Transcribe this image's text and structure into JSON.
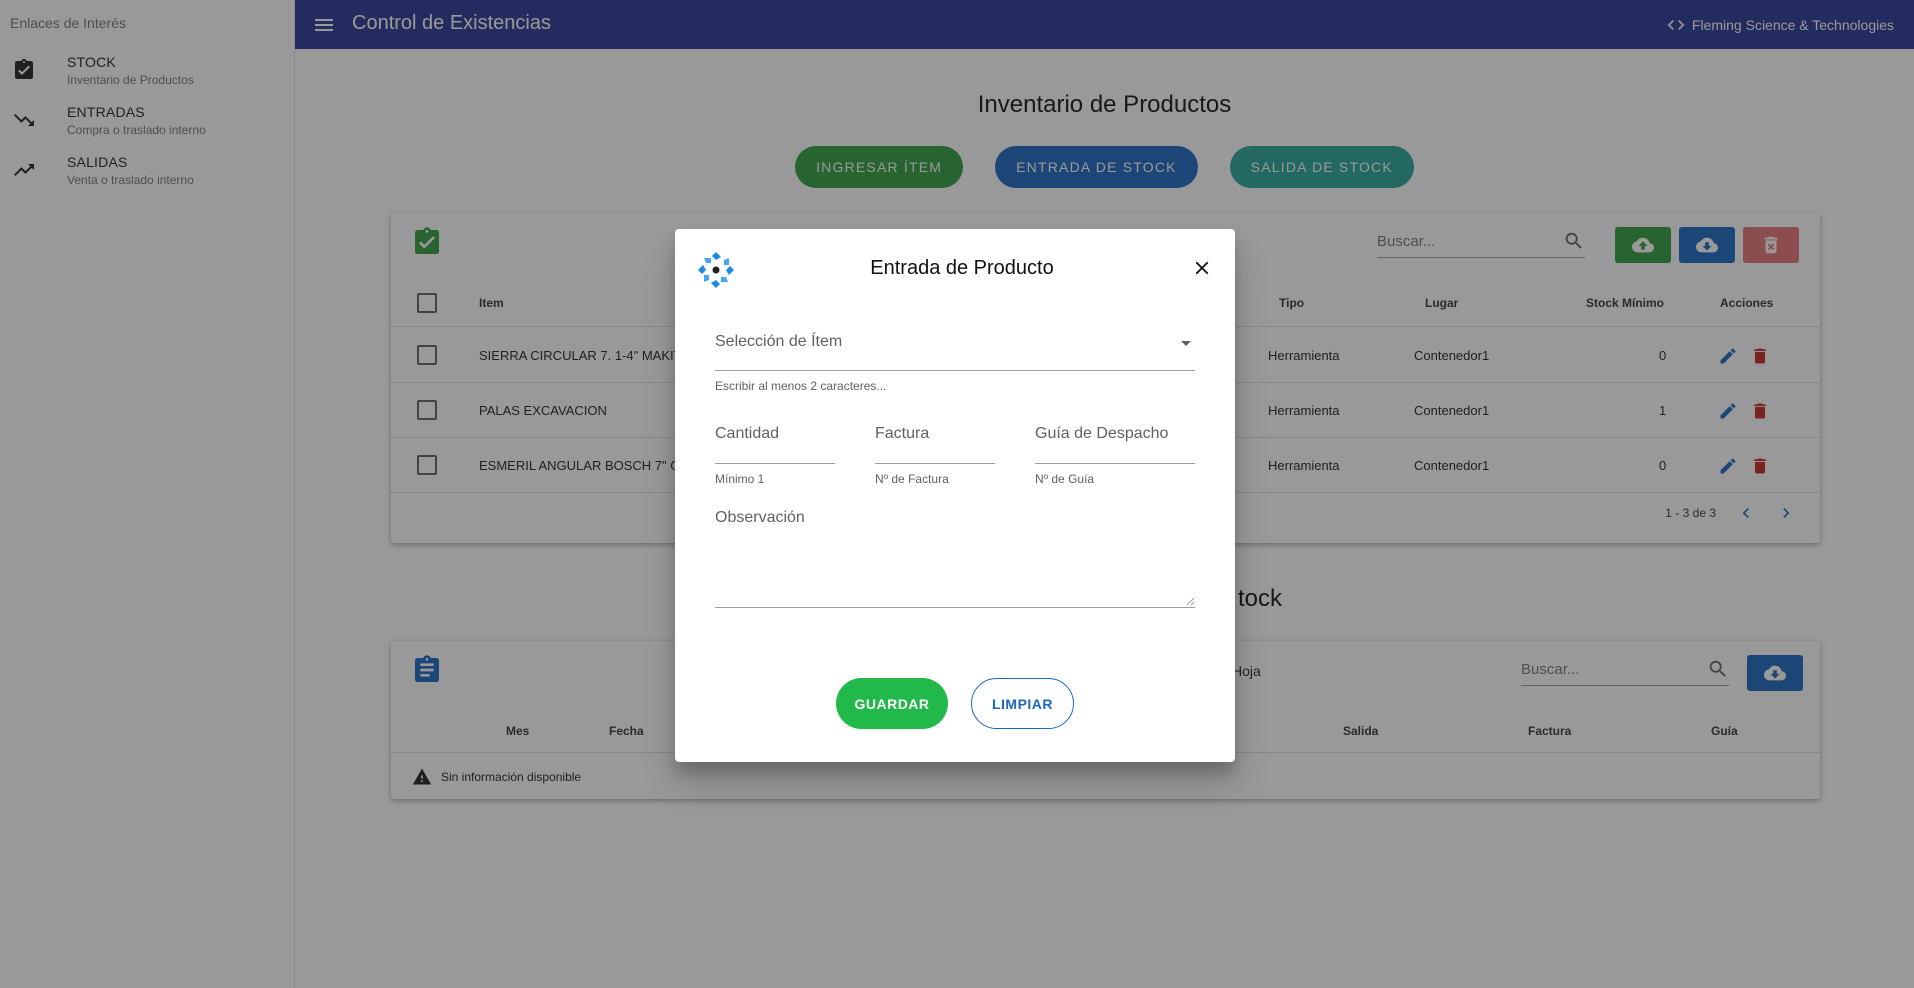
{
  "sidebar": {
    "title": "Enlaces de Interés",
    "items": [
      {
        "label": "STOCK",
        "sub": "Inventario de Productos",
        "icon": "clipboard-check-icon"
      },
      {
        "label": "ENTRADAS",
        "sub": "Compra o traslado interno",
        "icon": "trending-down-icon"
      },
      {
        "label": "SALIDAS",
        "sub": "Venta o traslado interno",
        "icon": "trending-up-icon"
      }
    ]
  },
  "appbar": {
    "title": "Control de Existencias",
    "brand": "Fleming Science & Technologies",
    "color": "#283593"
  },
  "main": {
    "title": "Inventario de Productos",
    "buttons": {
      "add_item": "INGRESAR ÍTEM",
      "stock_in": "ENTRADA DE STOCK",
      "stock_out": "SALIDA DE STOCK"
    },
    "search_placeholder": "Buscar...",
    "columns": {
      "item": "Item",
      "tipo": "Tipo",
      "lugar": "Lugar",
      "stock_min": "Stock Mínimo",
      "acciones": "Acciones"
    },
    "rows": [
      {
        "item": "SIERRA CIRCULAR 7. 1-4\" MAKITA",
        "tipo": "Herramienta",
        "lugar": "Contenedor1",
        "stock_min": "0"
      },
      {
        "item": "PALAS EXCAVACION",
        "tipo": "Herramienta",
        "lugar": "Contenedor1",
        "stock_min": "1"
      },
      {
        "item": "ESMERIL ANGULAR BOSCH 7\" GW",
        "tipo": "Herramienta",
        "lugar": "Contenedor1",
        "stock_min": "0"
      }
    ],
    "pagination": "1 - 3 de 3"
  },
  "section2": {
    "title_fragment": "tock",
    "hoja_fragment": "Hoja",
    "search_placeholder": "Buscar...",
    "columns": {
      "mes": "Mes",
      "fecha": "Fecha",
      "salida": "Salida",
      "factura": "Factura",
      "guia": "Guía"
    },
    "empty": "Sin información disponible"
  },
  "dialog": {
    "title": "Entrada de Producto",
    "item_select_label": "Selección de Ítem",
    "item_select_hint": "Escribir al menos 2 caracteres...",
    "cantidad_label": "Cantidad",
    "cantidad_hint": "Mínimo 1",
    "factura_label": "Factura",
    "factura_hint": "Nº de Factura",
    "guia_label": "Guía de Despacho",
    "guia_hint": "Nº de Guía",
    "observacion_label": "Observación",
    "save": "GUARDAR",
    "clear": "LIMPIAR"
  }
}
